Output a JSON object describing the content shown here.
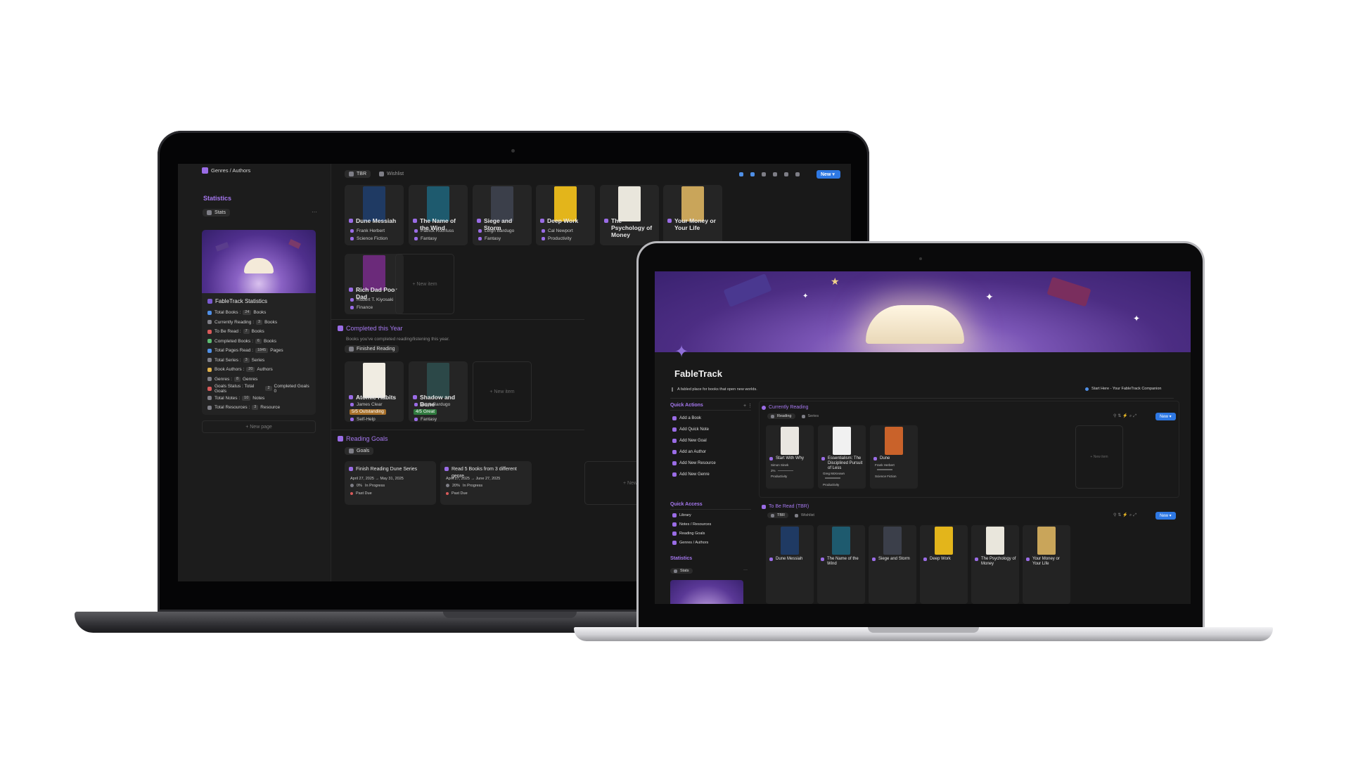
{
  "laptop1": {
    "sidebar": {
      "top_link": "Genres / Authors",
      "section_title": "Statistics",
      "view_tab": "Stats",
      "more": "···",
      "card_title": "FableTrack Statistics",
      "stats": [
        {
          "label": "Total Books :",
          "chip": "24",
          "unit": "Books",
          "icon": "b"
        },
        {
          "label": "Currently Reading :",
          "chip": "3",
          "unit": "Books",
          "icon": "g"
        },
        {
          "label": "To Be Read :",
          "chip": "7",
          "unit": "Books",
          "icon": "r"
        },
        {
          "label": "Completed Books :",
          "chip": "6",
          "unit": "Books",
          "icon": "gr"
        },
        {
          "label": "Total Pages Read :",
          "chip": "1845",
          "unit": "Pages",
          "icon": "b"
        },
        {
          "label": "Total Series :",
          "chip": "3",
          "unit": "Series",
          "icon": "g"
        },
        {
          "label": "Book Authors :",
          "chip": "20",
          "unit": "Authors",
          "icon": "y"
        },
        {
          "label": "Genres :",
          "chip": "8",
          "unit": "Genres",
          "icon": "g"
        },
        {
          "label": "Goals Status : Total Goals",
          "chip": "2",
          "unit": "Completed Goals 0",
          "icon": "r"
        },
        {
          "label": "Total Notes :",
          "chip": "10",
          "unit": "Notes",
          "icon": "g"
        },
        {
          "label": "Total Resources :",
          "chip": "3",
          "unit": "Resource",
          "icon": "g"
        }
      ],
      "new_page": "+ New page"
    },
    "tbr": {
      "tabs": [
        "TBR",
        "Wishlist"
      ],
      "new_button": "New",
      "books": [
        {
          "title": "Dune Messiah",
          "author": "Frank Herbert",
          "genre": "Science Fiction",
          "color": "#1f3a63"
        },
        {
          "title": "The Name of the Wind",
          "author": "Patrick Rothfuss",
          "genre": "Fantasy",
          "color": "#1e5a6e"
        },
        {
          "title": "Siege and Storm",
          "author": "Leigh Bardugo",
          "genre": "Fantasy",
          "color": "#3b3f4a"
        },
        {
          "title": "Deep Work",
          "author": "Cal Newport",
          "genre": "Productivity",
          "color": "#e3b51b"
        },
        {
          "title": "The Psychology of Money",
          "author": "",
          "genre": "",
          "color": "#e9e6dc"
        },
        {
          "title": "Your Money or Your Life",
          "author": "",
          "genre": "",
          "color": "#c9a55a"
        },
        {
          "title": "Rich Dad Poor Dad",
          "author": "Robert T. Kiyosaki",
          "genre": "Finance",
          "color": "#6b2a7a"
        }
      ],
      "new_item": "+ New item"
    },
    "completed": {
      "title": "Completed this Year",
      "subtitle": "Books you've completed reading/listening this year.",
      "view": "Finished Reading",
      "books": [
        {
          "title": "Atomic Habits",
          "author": "James Clear",
          "rating": "5/5 Outstanding",
          "genre": "Self-Help",
          "color": "#f0ece2"
        },
        {
          "title": "Shadow and Bone",
          "author": "Leigh Bardugo",
          "rating": "4/5 Great",
          "genre": "Fantasy",
          "color": "#2c4848"
        }
      ],
      "new_item": "+ New item"
    },
    "goals": {
      "title": "Reading Goals",
      "view": "Goals",
      "items": [
        {
          "title": "Finish Reading Dune Series",
          "dates": "April 27, 2025 → May 31, 2025",
          "progress": "0%",
          "status": "In Progress",
          "due": "Past Due"
        },
        {
          "title": "Read 5 Books from 3 different genre",
          "dates": "April 27, 2025 → June 27, 2025",
          "progress": "20%",
          "status": "In Progress",
          "due": "Past Due"
        }
      ],
      "new_item": "+ New"
    }
  },
  "laptop2": {
    "title": "FableTrack",
    "tagline": "A fabled place for books that open new worlds.",
    "start_link": "Start Here - Your FableTrack Companion",
    "quick_actions": {
      "title": "Quick Actions",
      "items": [
        "Add a Book",
        "Add Quick Note",
        "Add New Goal",
        "Add an Author",
        "Add New Resource",
        "Add New Genre"
      ]
    },
    "quick_access": {
      "title": "Quick Access",
      "items": [
        "Library",
        "Notes / Resources",
        "Reading Goals",
        "Genres / Authors"
      ]
    },
    "statistics": {
      "title": "Statistics",
      "tab": "Stats",
      "more": "···"
    },
    "currently_reading": {
      "title": "Currently Reading",
      "tabs": [
        "Reading",
        "Series"
      ],
      "new_button": "New",
      "books": [
        {
          "title": "Start With Why",
          "author": "Simon Sinek",
          "progress": "2%",
          "genre": "Productivity",
          "color": "#e9e6e0"
        },
        {
          "title": "Essentialism: The Disciplined Pursuit of Less",
          "author": "Greg McKeown",
          "progress": "",
          "genre": "Productivity",
          "color": "#f1f1f1"
        },
        {
          "title": "Dune",
          "author": "Frank Herbert",
          "progress": "",
          "genre": "Science Fiction",
          "color": "#c9622a"
        }
      ],
      "new_item": "+ New item"
    },
    "tbr": {
      "title": "To Be Read (TBR)",
      "tabs": [
        "TBR",
        "Wishlist"
      ],
      "new_button": "New",
      "books": [
        {
          "title": "Dune Messiah",
          "color": "#1f3a63"
        },
        {
          "title": "The Name of the Wind",
          "color": "#1e5a6e"
        },
        {
          "title": "Siege and Storm",
          "color": "#3b3f4a"
        },
        {
          "title": "Deep Work",
          "color": "#e3b51b"
        },
        {
          "title": "The Psychology of Money",
          "color": "#e9e6dc"
        },
        {
          "title": "Your Money or Your Life",
          "color": "#c9a55a"
        }
      ]
    }
  }
}
